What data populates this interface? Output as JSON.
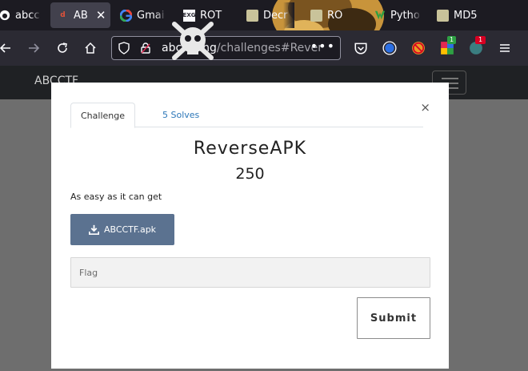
{
  "browser": {
    "tabs": [
      {
        "label": "abcc",
        "icon": "github-icon"
      },
      {
        "label": "AB",
        "icon": "ctf-icon",
        "active": true
      },
      {
        "label": "Gmai",
        "icon": "google-icon"
      },
      {
        "label": "ROT",
        "icon": "exg-icon"
      },
      {
        "label": "Decr",
        "icon": "folder-icon"
      },
      {
        "label": "RO",
        "icon": "folder-icon"
      },
      {
        "label": "Pytho",
        "icon": "python-icon"
      },
      {
        "label": "MD5",
        "icon": "folder-icon"
      }
    ],
    "close_glyph": "✕",
    "url_host": "abc.ctf.ng",
    "url_path": "/challenges#Rever",
    "url_menu": "•••",
    "extensions": [
      {
        "name": "pocket-icon"
      },
      {
        "name": "circle-extension-icon"
      },
      {
        "name": "blocked-extension-icon"
      },
      {
        "name": "colorful-extension-icon",
        "badge": "1",
        "badge_color": "#2ea043"
      },
      {
        "name": "shield-extension-icon",
        "badge": "1",
        "badge_color": "#d70022"
      }
    ]
  },
  "site": {
    "brand": "ABCCTF"
  },
  "modal": {
    "close": "×",
    "tabs": [
      "Challenge",
      "5 Solves"
    ],
    "challenge_name": "ReverseAPK",
    "challenge_value": "250",
    "description": "As easy as it can get",
    "file_button": "ABCCTF.apk",
    "flag_placeholder": "Flag",
    "submit_label": "Submit"
  },
  "colors": {
    "file_button": "#5b7290",
    "solves_link": "#2c77b8",
    "overlay": "#6e6e6e"
  }
}
